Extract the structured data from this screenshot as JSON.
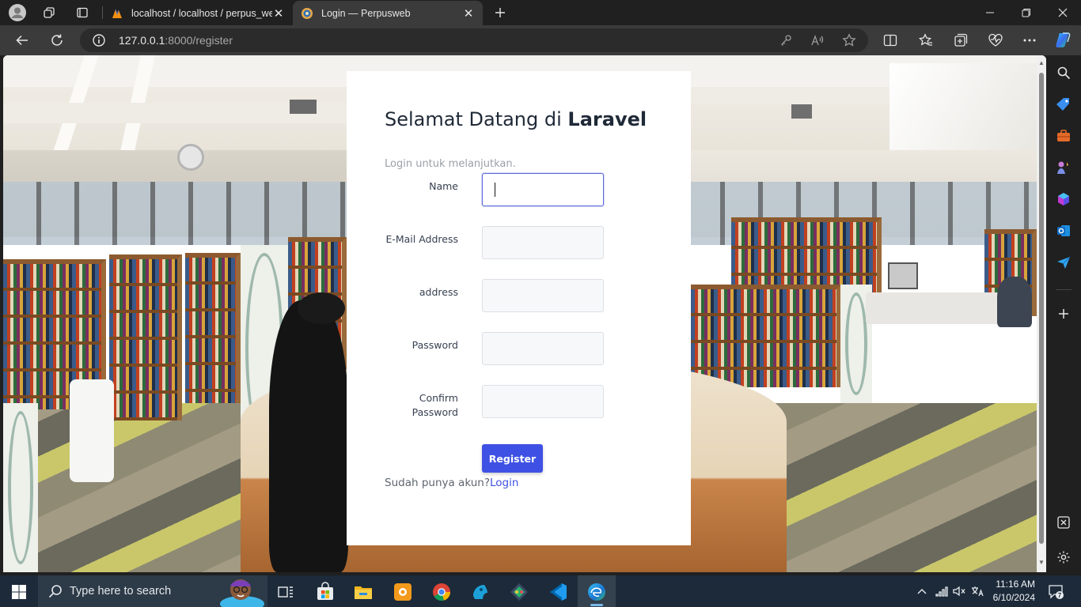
{
  "browser": {
    "tabs": [
      {
        "title": "localhost / localhost / perpus_web",
        "active": false
      },
      {
        "title": "Login — Perpusweb",
        "active": true
      }
    ],
    "url_host": "127.0.0.1",
    "url_rest": ":8000/register"
  },
  "form": {
    "greeting_prefix": "Selamat Datang di ",
    "greeting_brand": "Laravel",
    "subtitle": "Login untuk melanjutkan.",
    "fields": [
      {
        "label": "Name",
        "value": "",
        "focused": true
      },
      {
        "label": "E-Mail Address",
        "value": ""
      },
      {
        "label": "address",
        "value": ""
      },
      {
        "label": "Password",
        "value": ""
      },
      {
        "label": "Confirm Password",
        "value": ""
      }
    ],
    "register_label": "Register",
    "footer_text": "Sudah punya akun?",
    "login_link": "Login"
  },
  "taskbar": {
    "search_placeholder": "Type here to search",
    "time": "11:16 AM",
    "date": "6/10/2024",
    "notification_count": "7"
  },
  "colors": {
    "accent": "#3f51e4",
    "focus_border": "#5b6bd8",
    "browser_dark": "#202020"
  }
}
